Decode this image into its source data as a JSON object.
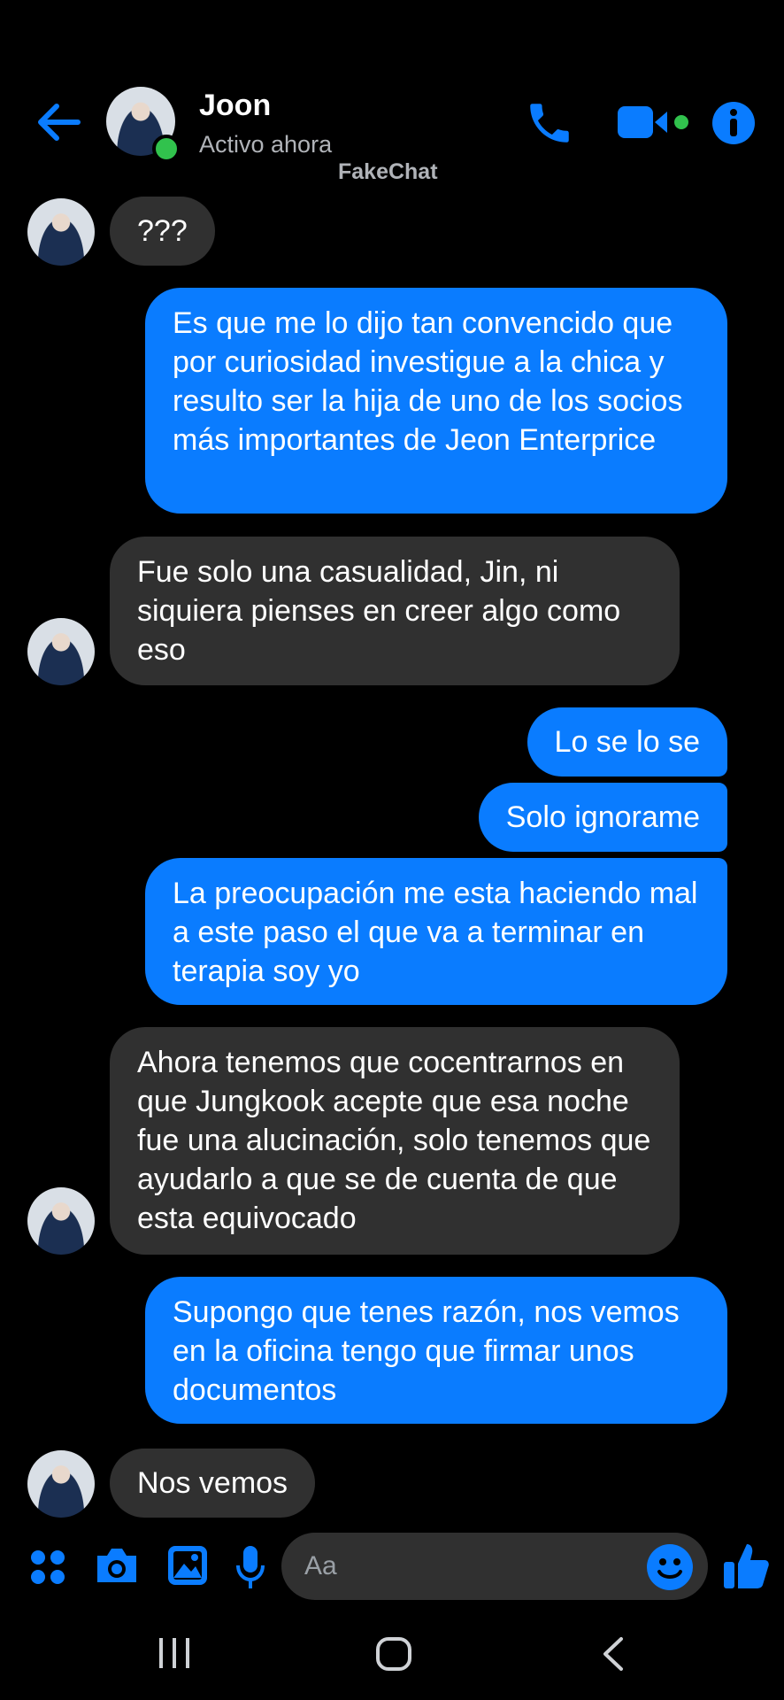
{
  "header": {
    "contact_name": "Joon",
    "status": "Activo ahora",
    "watermark": "FakeChat",
    "icons": [
      "back-arrow-icon",
      "phone-icon",
      "video-icon",
      "info-icon"
    ]
  },
  "colors": {
    "accent": "#0a7cff",
    "incoming_bubble": "#303030",
    "online": "#31c24d",
    "background": "#000000"
  },
  "messages": [
    {
      "from": "them",
      "text": "???"
    },
    {
      "from": "me",
      "text": "Es que me lo dijo tan convencido que por curiosidad investigue a la chica y resulto ser la hija de uno de los socios más importantes de Jeon Enterprice"
    },
    {
      "from": "them",
      "text": "Fue solo una casualidad, Jin, ni siquiera pienses en creer algo como eso"
    },
    {
      "from": "me",
      "text": "Lo se lo se"
    },
    {
      "from": "me",
      "text": "Solo ignorame"
    },
    {
      "from": "me",
      "text": "La preocupación me esta haciendo mal a este paso el que va a terminar en terapia soy yo"
    },
    {
      "from": "them",
      "text": "Ahora tenemos que cocentrarnos en que Jungkook acepte que esa noche fue una alucinación, solo tenemos que ayudarlo a que se de cuenta de que esta equivocado"
    },
    {
      "from": "me",
      "text": "Supongo que tenes razón, nos vemos en la oficina tengo que firmar unos documentos"
    },
    {
      "from": "them",
      "text": "Nos vemos"
    }
  ],
  "composer": {
    "placeholder": "Aa",
    "icons": [
      "apps-icon",
      "camera-icon",
      "gallery-icon",
      "microphone-icon",
      "emoji-icon",
      "thumbs-up-icon"
    ]
  },
  "system_nav": [
    "recents-icon",
    "home-icon",
    "back-icon"
  ]
}
